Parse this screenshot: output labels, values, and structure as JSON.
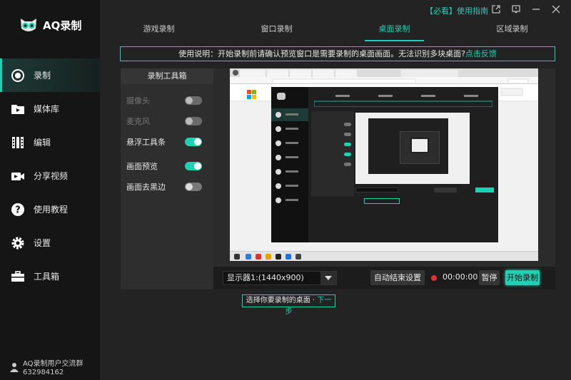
{
  "app": {
    "name": "AQ录制"
  },
  "topbar": {
    "guide": "【必看】使用指南"
  },
  "tabs": [
    {
      "label": "游戏录制"
    },
    {
      "label": "窗口录制"
    },
    {
      "label": "桌面录制"
    },
    {
      "label": "区域录制"
    }
  ],
  "nav": [
    {
      "label": "录制",
      "icon": "record-icon"
    },
    {
      "label": "媒体库",
      "icon": "media-library-icon"
    },
    {
      "label": "编辑",
      "icon": "film-edit-icon"
    },
    {
      "label": "分享视频",
      "icon": "share-video-icon"
    },
    {
      "label": "使用教程",
      "icon": "help-icon"
    },
    {
      "label": "设置",
      "icon": "gear-icon"
    },
    {
      "label": "工具箱",
      "icon": "toolbox-icon"
    }
  ],
  "footer": {
    "line1": "AQ录制用户交流群",
    "line2": "632984162"
  },
  "notice": {
    "text": "使用说明：开始录制前请确认预览窗口是需要录制的桌面画面。无法识别多块桌面?",
    "link": "点击反馈"
  },
  "toolbox": {
    "title": "录制工具箱",
    "items": [
      {
        "label": "摄像头",
        "on": false,
        "disabled": true
      },
      {
        "label": "麦克风",
        "on": false,
        "disabled": true
      },
      {
        "label": "悬浮工具条",
        "on": true,
        "disabled": false
      },
      {
        "label": "画面预览",
        "on": true,
        "disabled": false
      },
      {
        "label": "画面去黑边",
        "on": false,
        "disabled": false
      }
    ]
  },
  "controls": {
    "monitor": "显示器1:(1440x900)",
    "auto_stop": "自动结束设置",
    "timer": "00:00:00",
    "pause": "暂停",
    "start": "开始录制"
  },
  "hint": {
    "text": "选择你要录制的桌面 · ",
    "link": "下一步"
  },
  "colors": {
    "accent": "#1fd1b3",
    "sidebar": "#151515",
    "background": "#232323",
    "record": "#e0323a"
  }
}
